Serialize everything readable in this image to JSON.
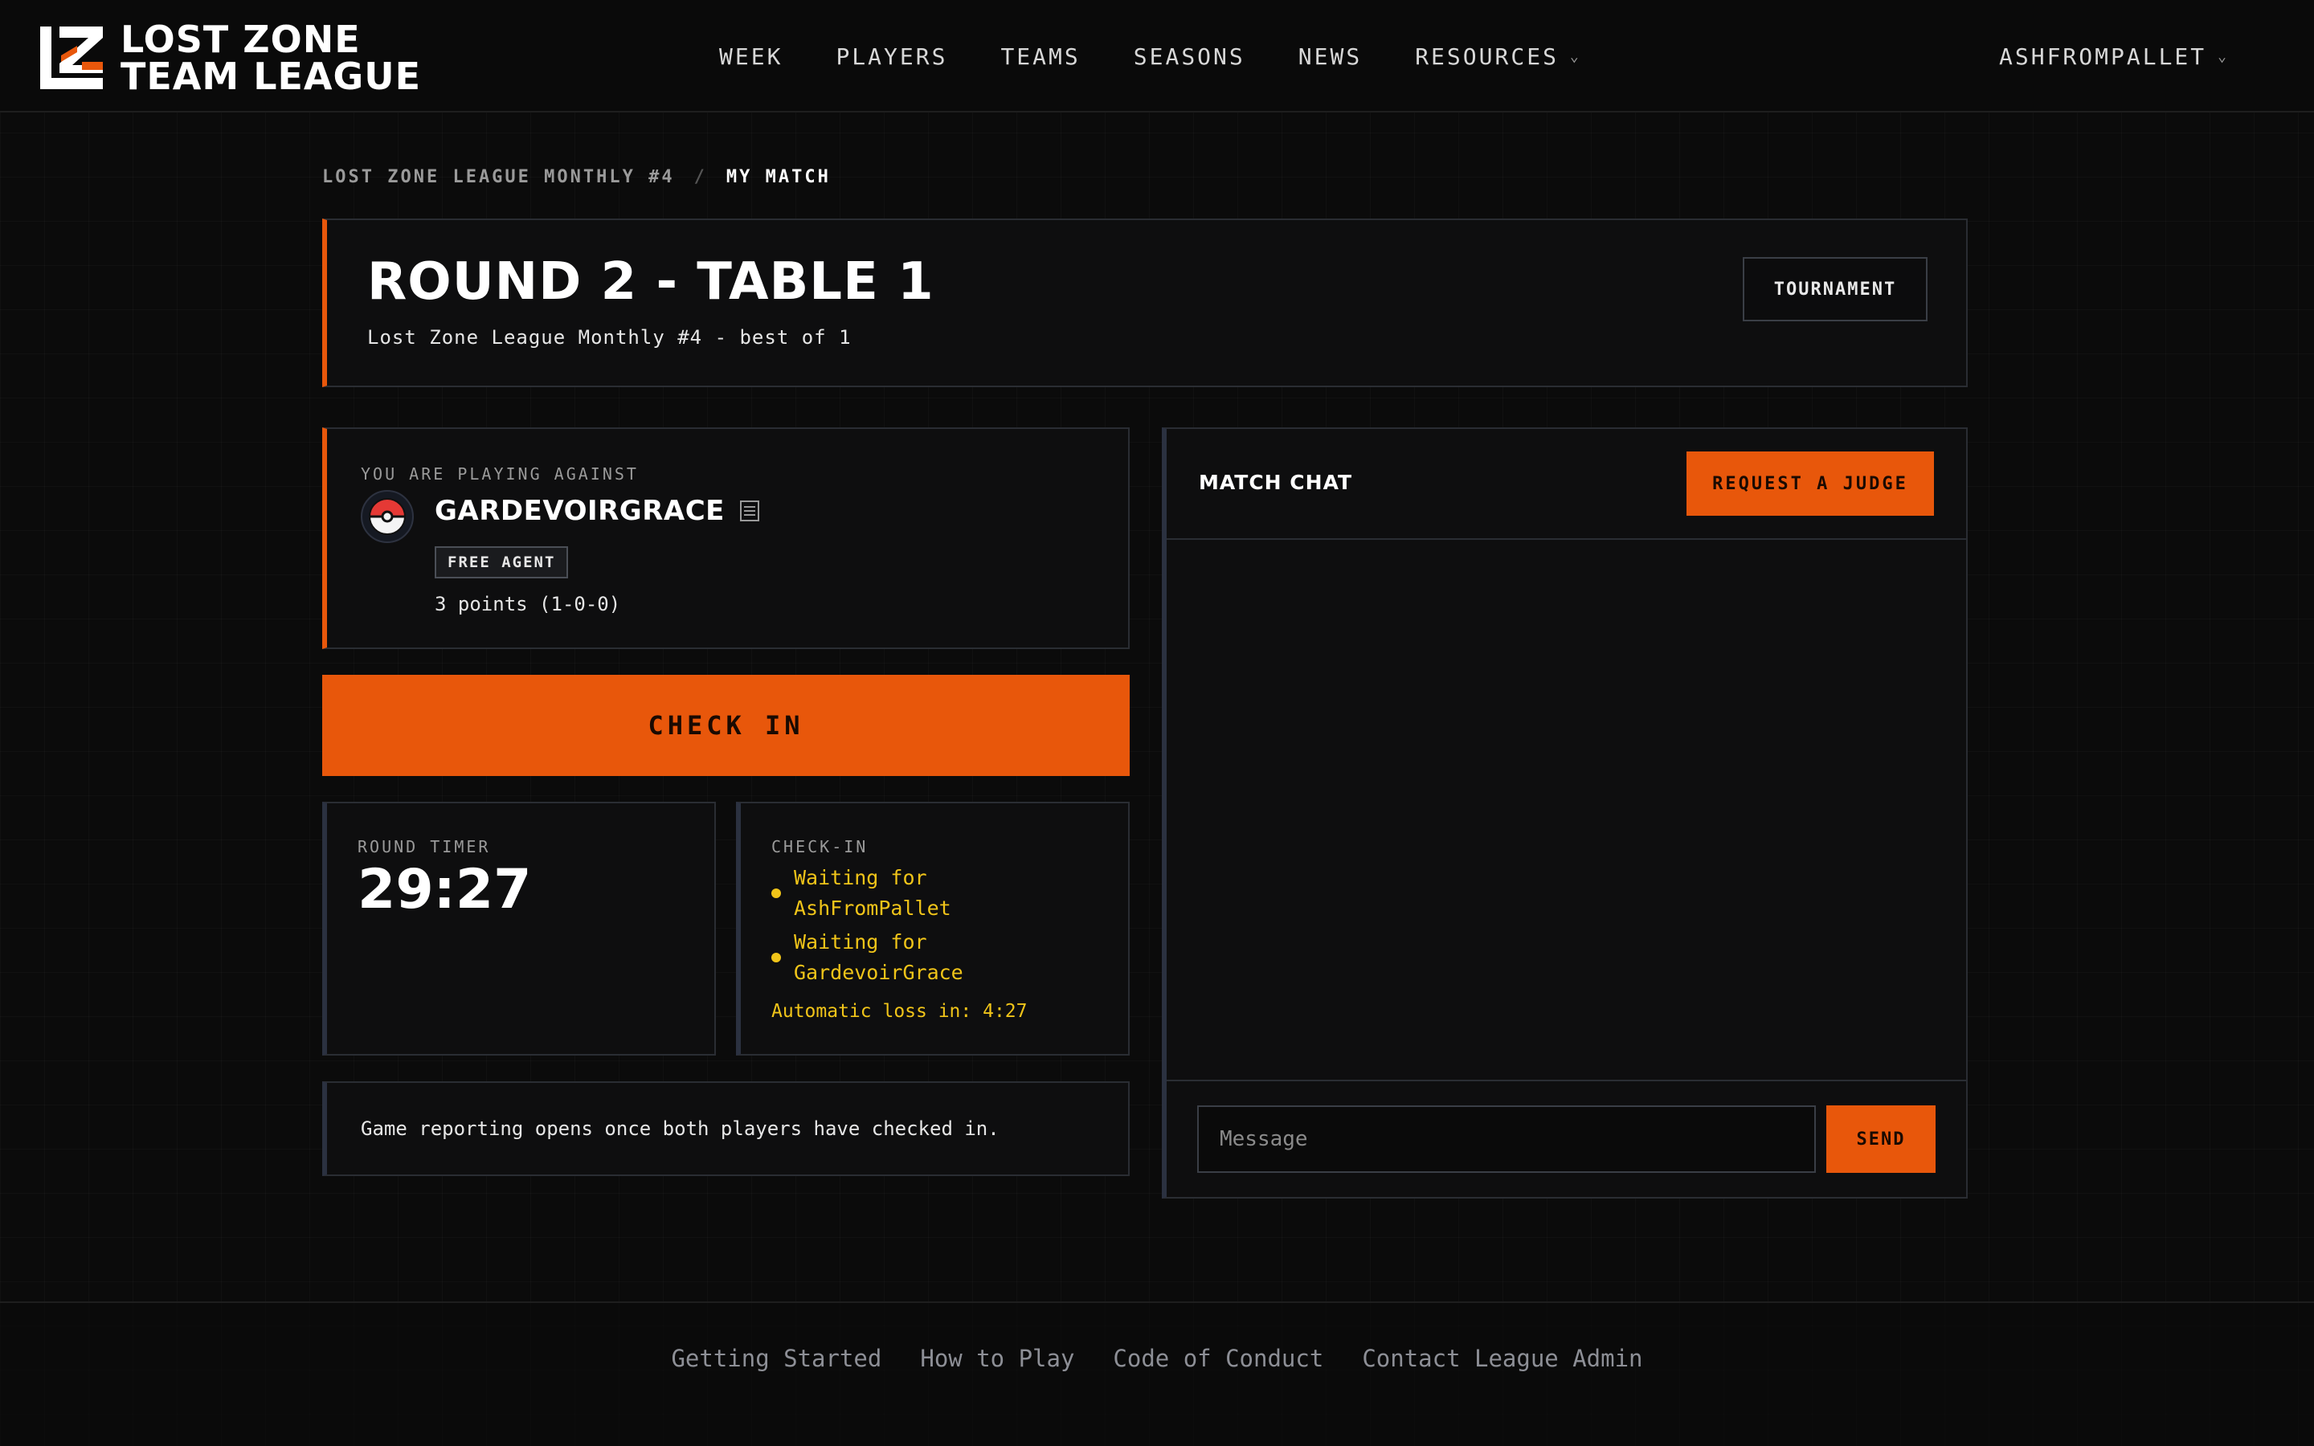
{
  "brand": {
    "logo_line1": "LOST ZONE",
    "logo_line2": "TEAM LEAGUE",
    "accent_color": "#e8570b"
  },
  "nav": {
    "items": [
      {
        "label": "WEEK"
      },
      {
        "label": "PLAYERS"
      },
      {
        "label": "TEAMS"
      },
      {
        "label": "SEASONS"
      },
      {
        "label": "NEWS"
      },
      {
        "label": "RESOURCES",
        "icon": "chevron-down-icon"
      }
    ],
    "user": "ASHFROMPALLET"
  },
  "breadcrumb": {
    "parent": "LOST ZONE LEAGUE MONTHLY #4",
    "separator": "/",
    "current": "MY MATCH"
  },
  "match": {
    "title": "ROUND 2 - TABLE 1",
    "subtitle": "Lost Zone League Monthly #4 - best of 1",
    "tournament_button": "TOURNAMENT"
  },
  "opponent": {
    "label": "YOU ARE PLAYING AGAINST",
    "name": "GARDEVOIRGRACE",
    "badge": "FREE AGENT",
    "points": "3 points (1-0-0)",
    "avatar_icon": "pokeball-icon"
  },
  "checkin_button": "CHECK IN",
  "timer": {
    "label": "ROUND TIMER",
    "value": "29:27"
  },
  "checkin_status": {
    "label": "CHECK-IN",
    "items": [
      {
        "line1": "Waiting for",
        "line2": "AshFromPallet"
      },
      {
        "line1": "Waiting for",
        "line2": "GardevoirGrace"
      }
    ],
    "auto_loss": "Automatic loss in: 4:27",
    "status_color": "#f0c419"
  },
  "info": {
    "text": "Game reporting opens once both players have checked in."
  },
  "chat": {
    "title": "MATCH CHAT",
    "judge_button": "REQUEST A JUDGE",
    "input_placeholder": "Message",
    "send_button": "SEND"
  },
  "footer": {
    "links": [
      "Getting Started",
      "How to Play",
      "Code of Conduct",
      "Contact League Admin"
    ]
  }
}
